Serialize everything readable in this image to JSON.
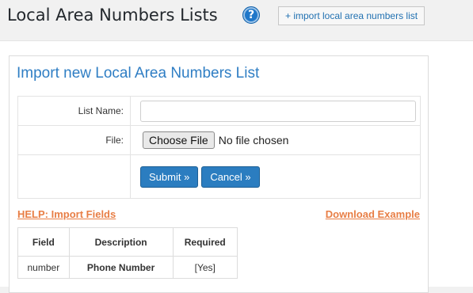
{
  "header": {
    "title": "Local Area Numbers Lists",
    "help_icon": "?",
    "import_link": "+ import local area numbers list"
  },
  "panel": {
    "heading": "Import new Local Area Numbers List",
    "form": {
      "list_name_label": "List Name:",
      "list_name_value": "",
      "file_label": "File:",
      "choose_file_label": "Choose File",
      "no_file_text": "No file chosen",
      "submit_label": "Submit »",
      "cancel_label": "Cancel »"
    },
    "help_link": "HELP: Import Fields",
    "download_link": "Download Example",
    "fields_table": {
      "headers": [
        "Field",
        "Description",
        "Required"
      ],
      "rows": [
        [
          "number",
          "Phone Number",
          "[Yes]"
        ]
      ]
    }
  },
  "icons": {
    "help": "help-circle-icon"
  },
  "colors": {
    "accent_blue": "#2b7dc0",
    "link_orange": "#e87e45",
    "heading_blue": "#2f7ec4"
  }
}
